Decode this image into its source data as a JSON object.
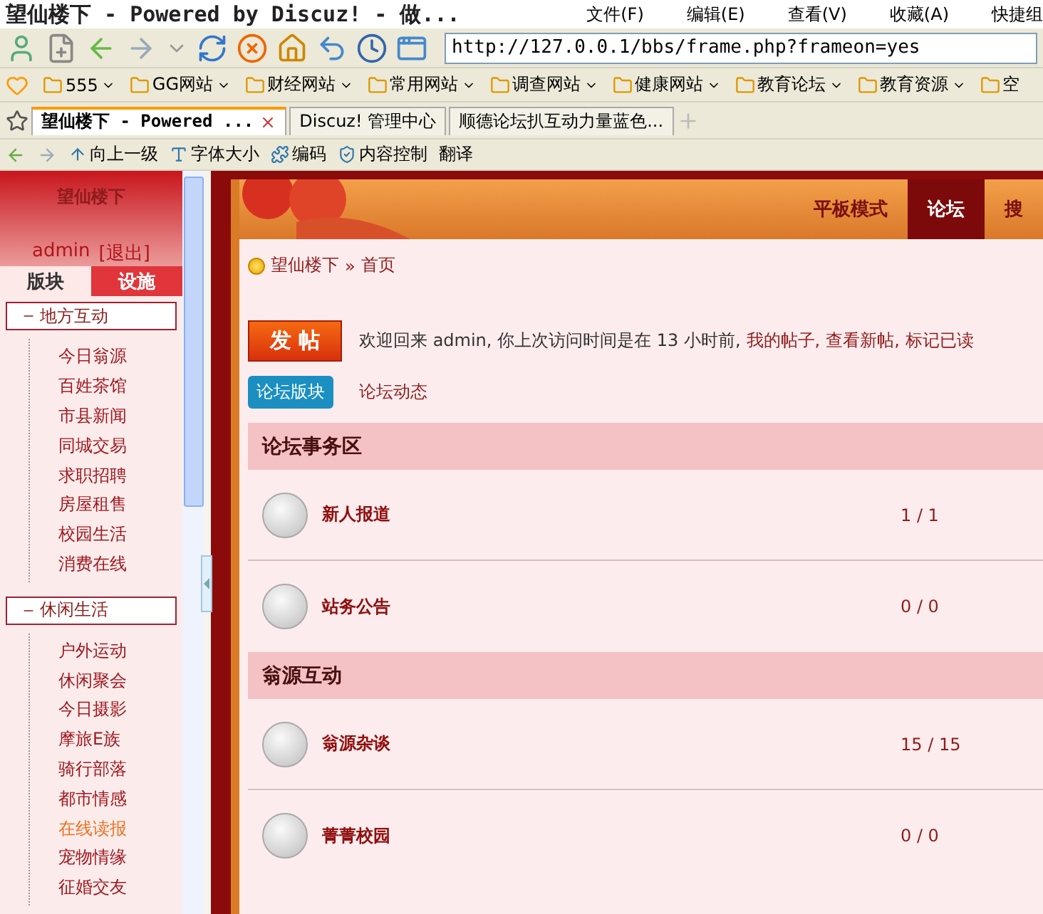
{
  "window": {
    "title": "望仙楼下 - Powered by Discuz! - 做...",
    "menu": [
      "文件(F)",
      "编辑(E)",
      "查看(V)",
      "收藏(A)",
      "快捷组"
    ]
  },
  "address": {
    "value": "http://127.0.0.1/bbs/frame.php?frameon=yes"
  },
  "bookmarks": [
    "555",
    "GG网站",
    "财经网站",
    "常用网站",
    "调查网站",
    "健康网站",
    "教育论坛",
    "教育资源",
    "空"
  ],
  "tabs": [
    {
      "label": "望仙楼下 - Powered ...",
      "selected": true
    },
    {
      "label": "Discuz! 管理中心",
      "selected": false
    },
    {
      "label": "顺德论坛扒互动力量蓝色...",
      "selected": false
    }
  ],
  "subtoolbar": [
    "向上一级",
    "字体大小",
    "编码",
    "内容控制",
    "翻译"
  ],
  "sidebar": {
    "title": "望仙楼下",
    "user": "admin",
    "logout": "[退出]",
    "tabs": [
      {
        "label": "版块",
        "selected": true
      },
      {
        "label": "设施",
        "selected": false
      }
    ],
    "groups": [
      {
        "label": "地方互动",
        "expanded": true,
        "children": [
          {
            "label": "今日翁源",
            "selected": false
          },
          {
            "label": "百姓茶馆",
            "selected": false
          },
          {
            "label": "市县新闻",
            "selected": false
          },
          {
            "label": "同城交易",
            "selected": false
          },
          {
            "label": "求职招聘",
            "selected": false
          },
          {
            "label": "房屋租售",
            "selected": false
          },
          {
            "label": "校园生活",
            "selected": false
          },
          {
            "label": "消费在线",
            "selected": false
          }
        ]
      },
      {
        "label": "休闲生活",
        "expanded": true,
        "children": [
          {
            "label": "户外运动",
            "selected": false
          },
          {
            "label": "休闲聚会",
            "selected": false
          },
          {
            "label": "今日摄影",
            "selected": false
          },
          {
            "label": "摩旅E族",
            "selected": false
          },
          {
            "label": "骑行部落",
            "selected": false
          },
          {
            "label": "都市情感",
            "selected": false
          },
          {
            "label": "在线读报",
            "selected": true
          },
          {
            "label": "宠物情缘",
            "selected": false
          },
          {
            "label": "征婚交友",
            "selected": false
          }
        ]
      }
    ]
  },
  "nav": [
    {
      "label": "平板模式",
      "selected": false
    },
    {
      "label": "论坛",
      "selected": true
    },
    {
      "label": "搜",
      "selected": false
    }
  ],
  "breadcrumb": {
    "home": "望仙楼下",
    "sep": "»",
    "current": "首页"
  },
  "post_button": "发 帖",
  "welcome": {
    "text": "欢迎回来 admin, 你上次访问时间是在 13 小时前,",
    "links": [
      "我的帖子,",
      "查看新帖,",
      "标记已读"
    ]
  },
  "views": [
    {
      "label": "论坛版块",
      "selected": true
    },
    {
      "label": "论坛动态",
      "selected": false
    }
  ],
  "sections": [
    {
      "title": "论坛事务区",
      "forums": [
        {
          "name": "新人报道",
          "count": "1 / 1"
        },
        {
          "name": "站务公告",
          "count": "0 / 0"
        }
      ]
    },
    {
      "title": "翁源互动",
      "forums": [
        {
          "name": "翁源杂谈",
          "count": "15 / 15"
        },
        {
          "name": "菁菁校园",
          "count": "0 / 0"
        }
      ]
    }
  ]
}
